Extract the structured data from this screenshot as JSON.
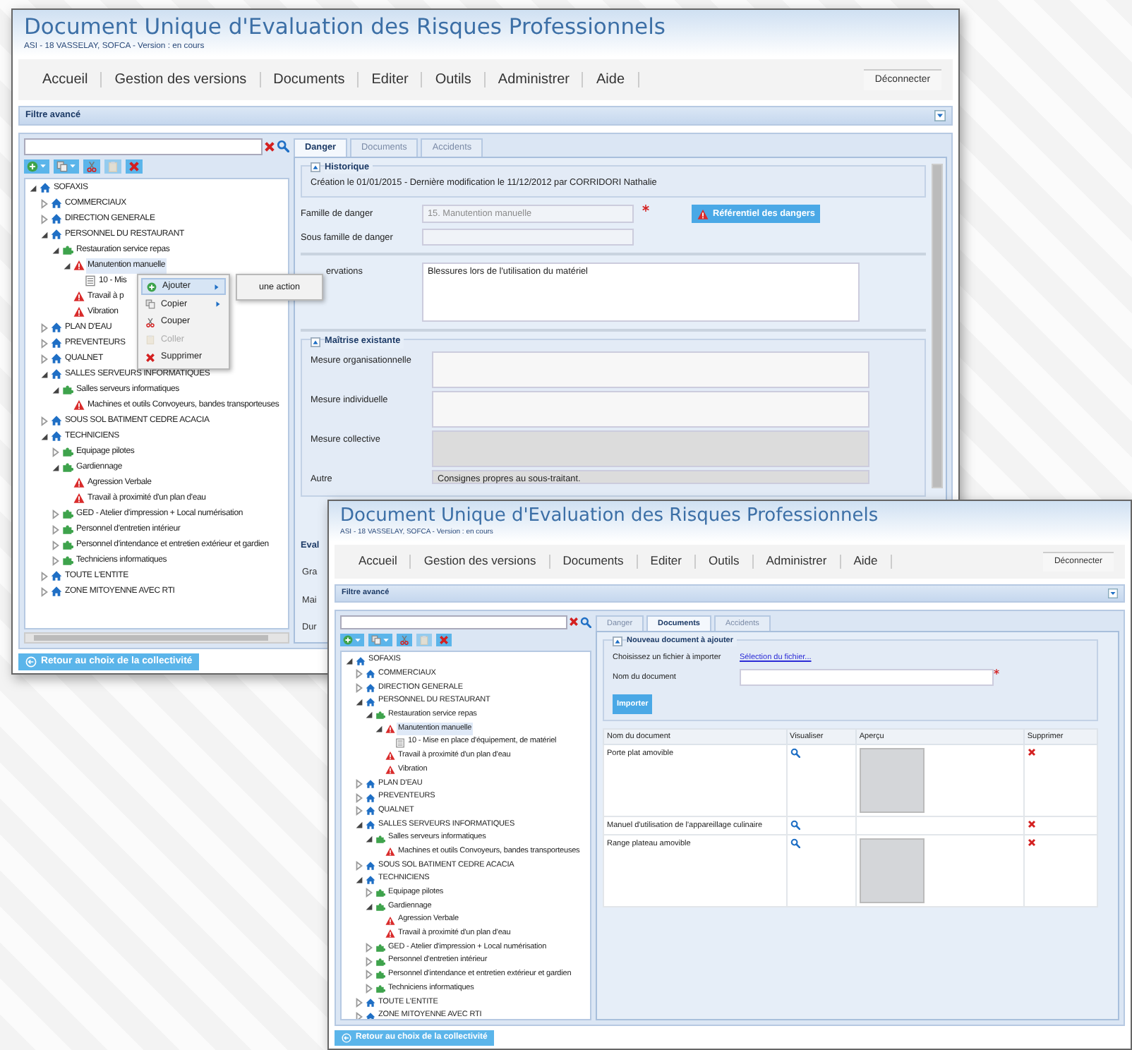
{
  "windows": [
    {
      "title": "Document Unique d'Evaluation des Risques Professionnels",
      "subtitle": "ASI - 18 VASSELAY, SOFCA - Version : en cours",
      "menu": [
        "Accueil",
        "Gestion des versions",
        "Documents",
        "Editer",
        "Outils",
        "Administrer",
        "Aide"
      ],
      "logout": "Déconnecter",
      "filter_label": "Filtre avancé",
      "tree": [
        {
          "label": "SOFAXIS",
          "kind": "entity",
          "expanded": true,
          "selected": false,
          "children": [
            {
              "label": "COMMERCIAUX",
              "kind": "entity",
              "expanded": false,
              "selected": false
            },
            {
              "label": "DIRECTION GENERALE",
              "kind": "entity",
              "expanded": false,
              "selected": false
            },
            {
              "label": "PERSONNEL DU RESTAURANT",
              "kind": "entity",
              "expanded": true,
              "selected": false,
              "children": [
                {
                  "label": "Restauration service repas",
                  "kind": "group",
                  "expanded": true,
                  "selected": false,
                  "children": [
                    {
                      "label": "Manutention manuelle",
                      "kind": "danger",
                      "expanded": true,
                      "selected": true,
                      "children": [
                        {
                          "label": "10 - Mis",
                          "kind": "action",
                          "selected": false
                        }
                      ]
                    },
                    {
                      "label": "Travail à p",
                      "kind": "danger",
                      "selected": false
                    },
                    {
                      "label": "Vibration",
                      "kind": "danger",
                      "selected": false
                    }
                  ]
                }
              ]
            },
            {
              "label": "PLAN D'EAU",
              "kind": "entity",
              "expanded": false,
              "selected": false
            },
            {
              "label": "PREVENTEURS",
              "kind": "entity",
              "expanded": false,
              "selected": false
            },
            {
              "label": "QUALNET",
              "kind": "entity",
              "expanded": false,
              "selected": false
            },
            {
              "label": "SALLES SERVEURS INFORMATIQUES",
              "kind": "entity",
              "expanded": true,
              "selected": false,
              "children": [
                {
                  "label": "Salles serveurs informatiques",
                  "kind": "group",
                  "expanded": true,
                  "selected": false,
                  "children": [
                    {
                      "label": "Machines et outils Convoyeurs, bandes transporteuses",
                      "kind": "danger",
                      "selected": false
                    }
                  ]
                }
              ]
            },
            {
              "label": "SOUS SOL BATIMENT CEDRE ACACIA",
              "kind": "entity",
              "expanded": false,
              "selected": false
            },
            {
              "label": "TECHNICIENS",
              "kind": "entity",
              "expanded": true,
              "selected": false,
              "children": [
                {
                  "label": "Equipage pilotes",
                  "kind": "group",
                  "expanded": false,
                  "selected": false
                },
                {
                  "label": "Gardiennage",
                  "kind": "group",
                  "expanded": true,
                  "selected": false,
                  "children": [
                    {
                      "label": "Agression Verbale",
                      "kind": "danger",
                      "selected": false
                    },
                    {
                      "label": "Travail à proximité d'un plan d'eau",
                      "kind": "danger",
                      "selected": false
                    }
                  ]
                },
                {
                  "label": "GED - Atelier d'impression + Local numérisation",
                  "kind": "group",
                  "expanded": false,
                  "selected": false
                },
                {
                  "label": "Personnel d'entretien intérieur",
                  "kind": "group",
                  "expanded": false,
                  "selected": false
                },
                {
                  "label": "Personnel d'intendance et entretien extérieur et gardien",
                  "kind": "group",
                  "expanded": false,
                  "selected": false
                },
                {
                  "label": "Techniciens informatiques",
                  "kind": "group",
                  "expanded": false,
                  "selected": false
                }
              ]
            },
            {
              "label": "TOUTE L'ENTITE",
              "kind": "entity",
              "expanded": false,
              "selected": false
            },
            {
              "label": "ZONE MITOYENNE AVEC RTI",
              "kind": "entity",
              "expanded": false,
              "selected": false
            }
          ]
        }
      ],
      "context_menu": {
        "items": [
          {
            "label": "Ajouter",
            "kind": "add",
            "selected": true,
            "disabled": false,
            "has_submenu": true
          },
          {
            "label": "Copier",
            "kind": "copy",
            "selected": false,
            "disabled": false,
            "has_submenu": true
          },
          {
            "label": "Couper",
            "kind": "cut",
            "selected": false,
            "disabled": false,
            "has_submenu": false
          },
          {
            "label": "Coller",
            "kind": "paste",
            "selected": false,
            "disabled": true,
            "has_submenu": false
          },
          {
            "label": "Supprimer",
            "kind": "delete",
            "selected": false,
            "disabled": false,
            "has_submenu": false
          }
        ],
        "submenu": [
          "une action"
        ]
      },
      "tabs": [
        {
          "label": "Danger",
          "selected": true
        },
        {
          "label": "Documents",
          "selected": false
        },
        {
          "label": "Accidents",
          "selected": false
        }
      ],
      "danger_form": {
        "history": {
          "legend": "Historique",
          "text": "Création le 01/01/2015 - Dernière modification le 11/12/2012 par CORRIDORI Nathalie"
        },
        "fields": [
          {
            "label": "Famille de danger",
            "value": "15. Manutention manuelle",
            "required": true,
            "disabled": true
          },
          {
            "label": "Sous famille de danger",
            "required": false,
            "disabled": true
          }
        ],
        "reference_button": "Référentiel des dangers",
        "observations": {
          "label": "ervations",
          "value": "Blessures lors de l'utilisation du matériel"
        },
        "controls": {
          "legend": "Maîtrise existante",
          "measures": [
            {
              "label": "Mesure organisationnelle",
              "disabled": false
            },
            {
              "label": "Mesure individuelle",
              "disabled": false
            },
            {
              "label": "Mesure collective",
              "disabled": true
            },
            {
              "label": "Autre",
              "value": "Consignes propres au sous-traitant.",
              "disabled": true
            }
          ]
        },
        "evaluation": {
          "legend": "Eval",
          "labels": [
            "Gra",
            "Mai",
            "Dur"
          ]
        }
      },
      "back_button": "Retour au choix de la collectivité"
    },
    {
      "title": "Document Unique d'Evaluation des Risques Professionnels",
      "subtitle": "ASI - 18 VASSELAY, SOFCA - Version : en cours",
      "menu": [
        "Accueil",
        "Gestion des versions",
        "Documents",
        "Editer",
        "Outils",
        "Administrer",
        "Aide"
      ],
      "logout": "Déconnecter",
      "filter_label": "Filtre avancé",
      "tree": [
        {
          "label": "SOFAXIS",
          "kind": "entity",
          "expanded": true,
          "selected": false,
          "children": [
            {
              "label": "COMMERCIAUX",
              "kind": "entity",
              "expanded": false,
              "selected": false
            },
            {
              "label": "DIRECTION GENERALE",
              "kind": "entity",
              "expanded": false,
              "selected": false
            },
            {
              "label": "PERSONNEL DU RESTAURANT",
              "kind": "entity",
              "expanded": true,
              "selected": false,
              "children": [
                {
                  "label": "Restauration service repas",
                  "kind": "group",
                  "expanded": true,
                  "selected": false,
                  "children": [
                    {
                      "label": "Manutention manuelle",
                      "kind": "danger",
                      "expanded": true,
                      "selected": true,
                      "children": [
                        {
                          "label": "10 - Mise en place d'équipement, de matériel",
                          "kind": "action",
                          "selected": false
                        }
                      ]
                    },
                    {
                      "label": "Travail à proximité d'un plan d'eau",
                      "kind": "danger",
                      "selected": false
                    },
                    {
                      "label": "Vibration",
                      "kind": "danger",
                      "selected": false
                    }
                  ]
                }
              ]
            },
            {
              "label": "PLAN D'EAU",
              "kind": "entity",
              "expanded": false,
              "selected": false
            },
            {
              "label": "PREVENTEURS",
              "kind": "entity",
              "expanded": false,
              "selected": false
            },
            {
              "label": "QUALNET",
              "kind": "entity",
              "expanded": false,
              "selected": false
            },
            {
              "label": "SALLES SERVEURS INFORMATIQUES",
              "kind": "entity",
              "expanded": true,
              "selected": false,
              "children": [
                {
                  "label": "Salles serveurs informatiques",
                  "kind": "group",
                  "expanded": true,
                  "selected": false,
                  "children": [
                    {
                      "label": "Machines et outils Convoyeurs, bandes transporteuses",
                      "kind": "danger",
                      "selected": false
                    }
                  ]
                }
              ]
            },
            {
              "label": "SOUS SOL BATIMENT CEDRE ACACIA",
              "kind": "entity",
              "expanded": false,
              "selected": false
            },
            {
              "label": "TECHNICIENS",
              "kind": "entity",
              "expanded": true,
              "selected": false,
              "children": [
                {
                  "label": "Equipage pilotes",
                  "kind": "group",
                  "expanded": false,
                  "selected": false
                },
                {
                  "label": "Gardiennage",
                  "kind": "group",
                  "expanded": true,
                  "selected": false,
                  "children": [
                    {
                      "label": "Agression Verbale",
                      "kind": "danger",
                      "selected": false
                    },
                    {
                      "label": "Travail à proximité d'un plan d'eau",
                      "kind": "danger",
                      "selected": false
                    }
                  ]
                },
                {
                  "label": "GED - Atelier d'impression + Local numérisation",
                  "kind": "group",
                  "expanded": false,
                  "selected": false
                },
                {
                  "label": "Personnel d'entretien intérieur",
                  "kind": "group",
                  "expanded": false,
                  "selected": false
                },
                {
                  "label": "Personnel d'intendance et entretien extérieur et gardien",
                  "kind": "group",
                  "expanded": false,
                  "selected": false
                },
                {
                  "label": "Techniciens informatiques",
                  "kind": "group",
                  "expanded": false,
                  "selected": false
                }
              ]
            },
            {
              "label": "TOUTE L'ENTITE",
              "kind": "entity",
              "expanded": false,
              "selected": false
            },
            {
              "label": "ZONE MITOYENNE AVEC RTI",
              "kind": "entity",
              "expanded": false,
              "selected": false
            }
          ]
        }
      ],
      "tabs": [
        {
          "label": "Danger",
          "selected": false
        },
        {
          "label": "Documents",
          "selected": true
        },
        {
          "label": "Accidents",
          "selected": false
        }
      ],
      "documents_form": {
        "legend": "Nouveau document à ajouter",
        "file_label": "Choisissez un fichier à importer",
        "file_link": "Sélection du fichier...",
        "name_label": "Nom du document",
        "name_required": true,
        "import_button": "Importer",
        "columns": [
          "Nom du document",
          "Visualiser",
          "Aperçu",
          "Supprimer"
        ],
        "rows": [
          {
            "name": "Porte plat amovible",
            "preview": true
          },
          {
            "name": "Manuel d'utilisation de l'appareillage culinaire",
            "preview": false
          },
          {
            "name": "Range plateau amovible",
            "preview": true
          }
        ]
      },
      "back_button": "Retour au choix de la collectivité"
    }
  ]
}
